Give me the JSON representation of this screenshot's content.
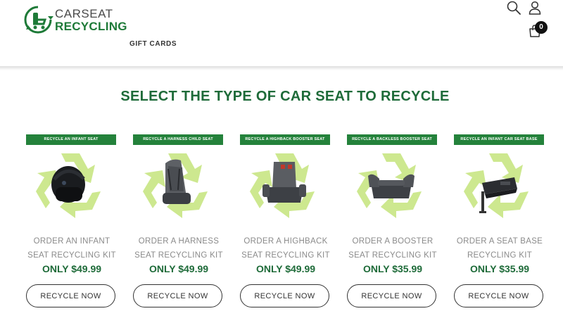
{
  "brand": {
    "line1": "CARSEAT",
    "line2": "RECYCLING"
  },
  "nav": {
    "gift_cards": "GIFT CARDS"
  },
  "header_icons": {
    "search": "search-icon",
    "account": "user-icon",
    "cart": "cart-icon",
    "cart_count": "0"
  },
  "page": {
    "title": "SELECT THE TYPE OF CAR SEAT TO RECYCLE"
  },
  "colors": {
    "brand_green": "#1e6b39",
    "banner_green": "#24823b",
    "recycle_green": "#cde88f"
  },
  "products": [
    {
      "banner": "RECYCLE AN INFANT SEAT",
      "name_line1": "ORDER AN INFANT",
      "name_line2": "SEAT RECYCLING KIT",
      "price": "ONLY $49.99",
      "button": "RECYCLE NOW",
      "image": "infant-car-seat"
    },
    {
      "banner": "RECYCLE A HARNESS CHILD SEAT",
      "name_line1": "ORDER A HARNESS",
      "name_line2": "SEAT RECYCLING KIT",
      "price": "ONLY $49.99",
      "button": "RECYCLE NOW",
      "image": "harness-car-seat"
    },
    {
      "banner": "RECYCLE A HIGHBACK BOOSTER SEAT",
      "name_line1": "ORDER A HIGHBACK",
      "name_line2": "SEAT RECYCLING KIT",
      "price": "ONLY $49.99",
      "button": "RECYCLE NOW",
      "image": "highback-booster-seat"
    },
    {
      "banner": "RECYCLE A BACKLESS BOOSTER SEAT",
      "name_line1": "ORDER A BOOSTER",
      "name_line2": "SEAT RECYCLING KIT",
      "price": "ONLY $35.99",
      "button": "RECYCLE NOW",
      "image": "backless-booster-seat"
    },
    {
      "banner": "RECYCLE AN INFANT CAR SEAT BASE",
      "name_line1": "ORDER A SEAT BASE",
      "name_line2": "RECYCLING KIT",
      "price": "ONLY $35.99",
      "button": "RECYCLE NOW",
      "image": "infant-seat-base"
    }
  ]
}
